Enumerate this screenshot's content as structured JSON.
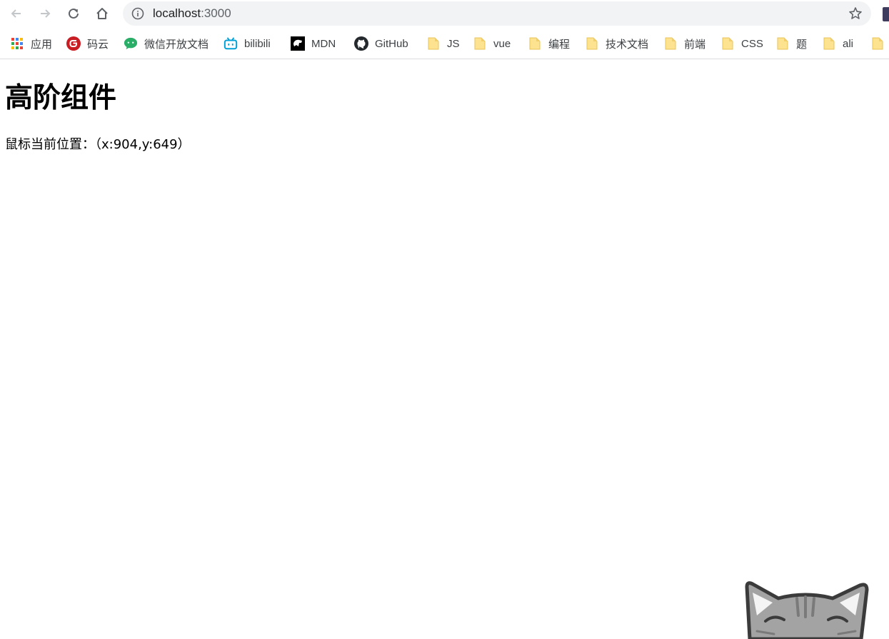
{
  "browser": {
    "url_host": "localhost",
    "url_port": ":3000"
  },
  "bookmarks": [
    {
      "label": "应用",
      "icon": "apps-grid-icon"
    },
    {
      "label": "码云",
      "icon": "gitee-icon"
    },
    {
      "label": "微信开放文档",
      "icon": "wechat-icon"
    },
    {
      "label": "bilibili",
      "icon": "bilibili-icon"
    },
    {
      "label": "MDN",
      "icon": "mdn-icon"
    },
    {
      "label": "GitHub",
      "icon": "github-icon"
    },
    {
      "label": "JS",
      "icon": "folder-icon"
    },
    {
      "label": "vue",
      "icon": "folder-icon"
    },
    {
      "label": "编程",
      "icon": "folder-icon"
    },
    {
      "label": "技术文档",
      "icon": "folder-icon"
    },
    {
      "label": "前端",
      "icon": "folder-icon"
    },
    {
      "label": "CSS",
      "icon": "folder-icon"
    },
    {
      "label": "题",
      "icon": "folder-icon"
    },
    {
      "label": "ali",
      "icon": "folder-icon"
    }
  ],
  "page": {
    "title": "高阶组件",
    "mouse_position": "鼠标当前位置：（x:904,y:649）"
  },
  "colors": {
    "gitee": "#c71d23",
    "wechat": "#2aae67",
    "bilibili": "#00a1d6",
    "folder": "#f7d774"
  }
}
